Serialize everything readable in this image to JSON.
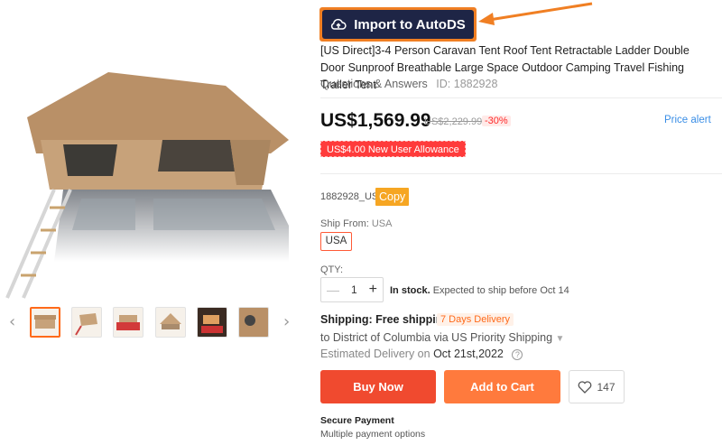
{
  "extension": {
    "import_label": "Import to AutoDS"
  },
  "product": {
    "title": "[US Direct]3-4 Person Caravan Tent Roof Tent Retractable Ladder Double Door Sunproof Breathable Large Space Outdoor Camping Travel Fishing Trailer Tent",
    "qa_link": "Questions & Answers",
    "id_text": "ID: 1882928",
    "price": "US$1,569.99",
    "old_price": "US$2,229.99",
    "discount": "-30%",
    "price_alert": "Price alert",
    "allowance": "US$4.00 New User Allowance",
    "sku": "1882928_US",
    "copy_label": "Copy",
    "ship_from_label": "Ship From:",
    "ship_from_value": "USA",
    "ship_option": "USA",
    "qty_label": "QTY:",
    "qty_value": "1",
    "stock_bold": "In stock.",
    "stock_text": "Expected to ship before Oct 14",
    "shipping_label": "Shipping: Free shipping",
    "delivery_badge": "7 Days Delivery",
    "ship_to": "to District of Columbia via US Priority Shipping",
    "est_label": "Estimated Delivery on",
    "est_date": "Oct 21st,2022",
    "buy_now": "Buy Now",
    "add_to_cart": "Add to Cart",
    "wishlist_count": "147",
    "secure_title": "Secure Payment",
    "secure_sub": "Multiple payment options"
  },
  "colors": {
    "buy_now": "#f04a2f",
    "add_to_cart": "#ff7a3d",
    "import_bg": "#1e2546",
    "import_border": "#f07f23",
    "price_alert": "#3a8ee6"
  },
  "gallery": {
    "thumbnails": [
      "tent-front",
      "tent-ladder",
      "tent-on-red-car",
      "tent-open-side",
      "tent-at-dusk",
      "tent-closeup"
    ],
    "active_index": 0
  }
}
